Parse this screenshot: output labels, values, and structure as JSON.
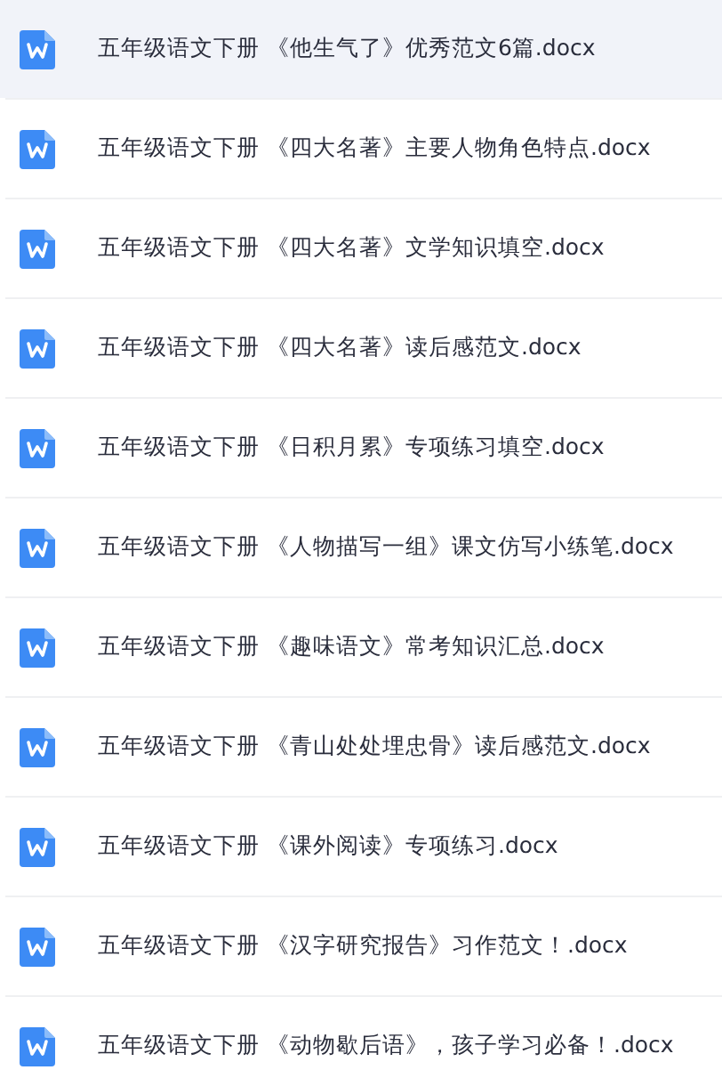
{
  "files": [
    {
      "name": "五年级语文下册 《他生气了》优秀范文6篇.docx",
      "selected": true
    },
    {
      "name": "五年级语文下册 《四大名著》主要人物角色特点.docx",
      "selected": false
    },
    {
      "name": "五年级语文下册 《四大名著》文学知识填空.docx",
      "selected": false
    },
    {
      "name": "五年级语文下册 《四大名著》读后感范文.docx",
      "selected": false
    },
    {
      "name": "五年级语文下册 《日积月累》专项练习填空.docx",
      "selected": false
    },
    {
      "name": "五年级语文下册 《人物描写一组》课文仿写小练笔.docx",
      "selected": false
    },
    {
      "name": "五年级语文下册 《趣味语文》常考知识汇总.docx",
      "selected": false
    },
    {
      "name": "五年级语文下册 《青山处处埋忠骨》读后感范文.docx",
      "selected": false
    },
    {
      "name": "五年级语文下册 《课外阅读》专项练习.docx",
      "selected": false
    },
    {
      "name": "五年级语文下册 《汉字研究报告》习作范文！.docx",
      "selected": false
    },
    {
      "name": "五年级语文下册 《动物歇后语》，孩子学习必备！.docx",
      "selected": false
    }
  ]
}
